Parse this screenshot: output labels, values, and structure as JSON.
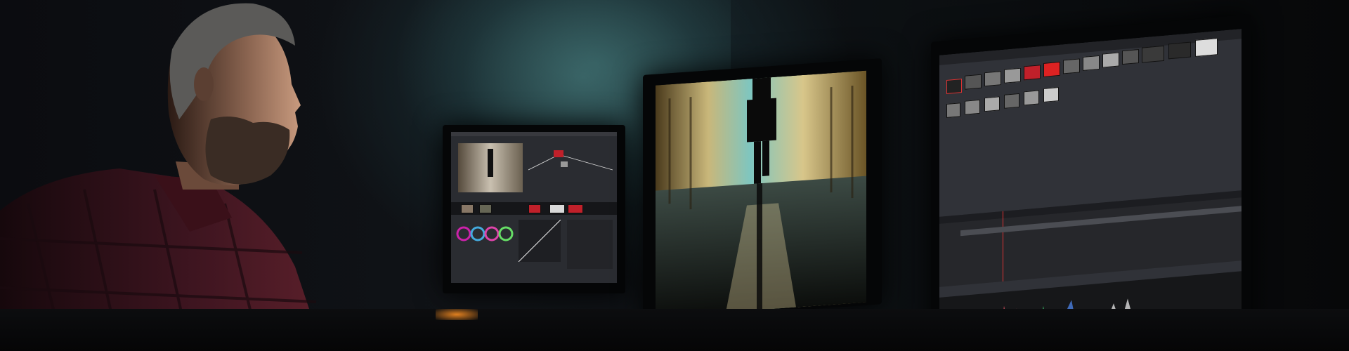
{
  "scene": {
    "description_icon": "person-at-color-grading-workstation",
    "colors": {
      "background": "#08090c",
      "screen_ui": "#2a2c31",
      "wall_glow": "#2f4d50",
      "shirt_red": "#5a1f2a",
      "clip_red": "#c0202a",
      "scope_green": "#3cc46a"
    }
  },
  "monitors": [
    {
      "name": "left-monitor",
      "content": "editing-timeline-with-color-wheels"
    },
    {
      "name": "center-monitor",
      "content": "full-screen-video-preview"
    },
    {
      "name": "right-monitor",
      "content": "media-pool-thumbnails-and-scopes"
    }
  ]
}
